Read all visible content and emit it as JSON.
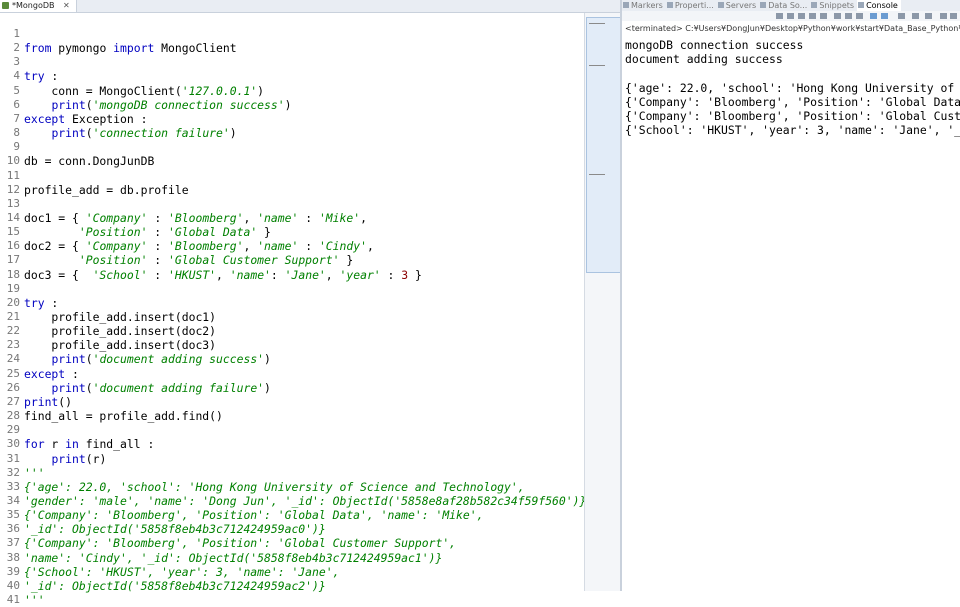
{
  "editor": {
    "tab_label": "*MongoDB",
    "tab_close": "✕",
    "lines": [
      {
        "num": "1",
        "segs": []
      },
      {
        "num": "2",
        "segs": [
          [
            "kw",
            "from"
          ],
          [
            "t",
            " pymongo "
          ],
          [
            "kw",
            "import"
          ],
          [
            "t",
            " MongoClient"
          ]
        ]
      },
      {
        "num": "3",
        "segs": []
      },
      {
        "num": "4",
        "segs": [
          [
            "kw",
            "try"
          ],
          [
            "t",
            " :"
          ]
        ]
      },
      {
        "num": "5",
        "segs": [
          [
            "t",
            "    conn = MongoClient("
          ],
          [
            "str",
            "'127.0.0.1'"
          ],
          [
            "t",
            ")"
          ]
        ]
      },
      {
        "num": "6",
        "segs": [
          [
            "t",
            "    "
          ],
          [
            "kw",
            "print"
          ],
          [
            "t",
            "("
          ],
          [
            "str",
            "'mongoDB connection success'"
          ],
          [
            "t",
            ")"
          ]
        ]
      },
      {
        "num": "7",
        "segs": [
          [
            "kw",
            "except"
          ],
          [
            "t",
            " Exception :"
          ]
        ]
      },
      {
        "num": "8",
        "segs": [
          [
            "t",
            "    "
          ],
          [
            "kw",
            "print"
          ],
          [
            "t",
            "("
          ],
          [
            "str",
            "'connection failure'"
          ],
          [
            "t",
            ")"
          ]
        ]
      },
      {
        "num": "9",
        "segs": []
      },
      {
        "num": "10",
        "segs": [
          [
            "t",
            "db = conn.DongJunDB"
          ]
        ]
      },
      {
        "num": "11",
        "segs": []
      },
      {
        "num": "12",
        "segs": [
          [
            "t",
            "profile_add = db.profile"
          ]
        ]
      },
      {
        "num": "13",
        "segs": []
      },
      {
        "num": "14",
        "segs": [
          [
            "t",
            "doc1 = { "
          ],
          [
            "str",
            "'Company'"
          ],
          [
            "t",
            " : "
          ],
          [
            "str",
            "'Bloomberg'"
          ],
          [
            "t",
            ", "
          ],
          [
            "str",
            "'name'"
          ],
          [
            "t",
            " : "
          ],
          [
            "str",
            "'Mike'"
          ],
          [
            "t",
            ","
          ]
        ]
      },
      {
        "num": "15",
        "segs": [
          [
            "t",
            "        "
          ],
          [
            "str",
            "'Position'"
          ],
          [
            "t",
            " : "
          ],
          [
            "str",
            "'Global Data'"
          ],
          [
            "t",
            " }"
          ]
        ]
      },
      {
        "num": "16",
        "segs": [
          [
            "t",
            "doc2 = { "
          ],
          [
            "str",
            "'Company'"
          ],
          [
            "t",
            " : "
          ],
          [
            "str",
            "'Bloomberg'"
          ],
          [
            "t",
            ", "
          ],
          [
            "str",
            "'name'"
          ],
          [
            "t",
            " : "
          ],
          [
            "str",
            "'Cindy'"
          ],
          [
            "t",
            ","
          ]
        ]
      },
      {
        "num": "17",
        "segs": [
          [
            "t",
            "        "
          ],
          [
            "str",
            "'Position'"
          ],
          [
            "t",
            " : "
          ],
          [
            "str",
            "'Global Customer Support'"
          ],
          [
            "t",
            " }"
          ]
        ]
      },
      {
        "num": "18",
        "segs": [
          [
            "t",
            "doc3 = {  "
          ],
          [
            "str",
            "'School'"
          ],
          [
            "t",
            " : "
          ],
          [
            "str",
            "'HKUST'"
          ],
          [
            "t",
            ", "
          ],
          [
            "str",
            "'name'"
          ],
          [
            "t",
            ": "
          ],
          [
            "str",
            "'Jane'"
          ],
          [
            "t",
            ", "
          ],
          [
            "str",
            "'year'"
          ],
          [
            "t",
            " : "
          ],
          [
            "num",
            "3"
          ],
          [
            "t",
            " }"
          ]
        ]
      },
      {
        "num": "19",
        "segs": []
      },
      {
        "num": "20",
        "segs": [
          [
            "kw",
            "try"
          ],
          [
            "t",
            " :"
          ]
        ]
      },
      {
        "num": "21",
        "segs": [
          [
            "t",
            "    profile_add.insert(doc1)"
          ]
        ]
      },
      {
        "num": "22",
        "segs": [
          [
            "t",
            "    profile_add.insert(doc2)"
          ]
        ]
      },
      {
        "num": "23",
        "segs": [
          [
            "t",
            "    profile_add.insert(doc3)"
          ]
        ]
      },
      {
        "num": "24",
        "segs": [
          [
            "t",
            "    "
          ],
          [
            "kw",
            "print"
          ],
          [
            "t",
            "("
          ],
          [
            "str",
            "'document adding success'"
          ],
          [
            "t",
            ")"
          ]
        ]
      },
      {
        "num": "25",
        "segs": [
          [
            "kw",
            "except"
          ],
          [
            "t",
            " :"
          ]
        ]
      },
      {
        "num": "26",
        "segs": [
          [
            "t",
            "    "
          ],
          [
            "kw",
            "print"
          ],
          [
            "t",
            "("
          ],
          [
            "str",
            "'document adding failure'"
          ],
          [
            "t",
            ")"
          ]
        ]
      },
      {
        "num": "27",
        "segs": [
          [
            "kw",
            "print"
          ],
          [
            "t",
            "()"
          ]
        ]
      },
      {
        "num": "28",
        "segs": [
          [
            "t",
            "find_all = profile_add.find()"
          ]
        ]
      },
      {
        "num": "29",
        "segs": []
      },
      {
        "num": "30",
        "segs": [
          [
            "kw",
            "for"
          ],
          [
            "t",
            " r "
          ],
          [
            "kw",
            "in"
          ],
          [
            "t",
            " find_all :"
          ]
        ]
      },
      {
        "num": "31",
        "segs": [
          [
            "t",
            "    "
          ],
          [
            "kw",
            "print"
          ],
          [
            "t",
            "(r)"
          ]
        ]
      },
      {
        "num": "32",
        "segs": [
          [
            "com",
            "'''"
          ]
        ]
      },
      {
        "num": "33",
        "segs": [
          [
            "com",
            "{'age': 22.0, 'school': 'Hong Kong University of Science and Technology',"
          ]
        ]
      },
      {
        "num": "34",
        "segs": [
          [
            "com",
            "'gender': 'male', 'name': 'Dong Jun', '_id': ObjectId('5858e8af28b582c34f59f560')}"
          ]
        ]
      },
      {
        "num": "35",
        "segs": [
          [
            "com",
            "{'Company': 'Bloomberg', 'Position': 'Global Data', 'name': 'Mike',"
          ]
        ]
      },
      {
        "num": "36",
        "segs": [
          [
            "com",
            "'_id': ObjectId('5858f8eb4b3c712424959ac0')}"
          ]
        ]
      },
      {
        "num": "37",
        "segs": [
          [
            "com",
            "{'Company': 'Bloomberg', 'Position': 'Global Customer Support',"
          ]
        ]
      },
      {
        "num": "38",
        "segs": [
          [
            "com",
            "'name': 'Cindy', '_id': ObjectId('5858f8eb4b3c712424959ac1')}"
          ]
        ]
      },
      {
        "num": "39",
        "segs": [
          [
            "com",
            "{'School': 'HKUST', 'year': 3, 'name': 'Jane',"
          ]
        ]
      },
      {
        "num": "40",
        "segs": [
          [
            "com",
            "'_id': ObjectId('5858f8eb4b3c712424959ac2')}"
          ]
        ]
      },
      {
        "num": "41",
        "segs": [
          [
            "com",
            "'''"
          ]
        ]
      }
    ]
  },
  "console": {
    "tabs": [
      "Markers",
      "Properti...",
      "Servers",
      "Data So...",
      "Snippets",
      "Console"
    ],
    "active_tab": "Console",
    "terminated": "<terminated> C:¥Users¥DongJun¥Desktop¥Python¥work¥start¥Data_Base_Python¥",
    "output": [
      "mongoDB connection success",
      "document adding success",
      "",
      "{'age': 22.0, 'school': 'Hong Kong University of",
      "{'Company': 'Bloomberg', 'Position': 'Global Data",
      "{'Company': 'Bloomberg', 'Position': 'Global Cust",
      "{'School': 'HKUST', 'year': 3, 'name': 'Jane', '_"
    ]
  },
  "colors": {
    "keyword": "#0000c0",
    "string": "#008000",
    "number": "#8b0000"
  }
}
